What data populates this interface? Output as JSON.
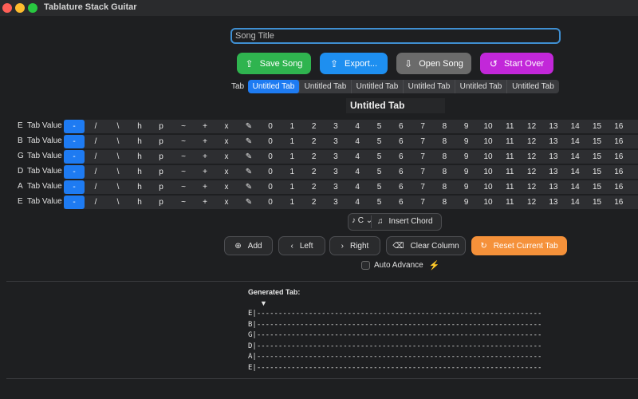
{
  "window": {
    "title": "Tablature Stack Guitar"
  },
  "song": {
    "title_placeholder": "Song Title",
    "title_value": ""
  },
  "actions": {
    "save": "Save Song",
    "export": "Export...",
    "open": "Open Song",
    "start_over": "Start Over"
  },
  "tabs": {
    "label": "Tab",
    "items": [
      "Untitled Tab",
      "Untitled Tab",
      "Untitled Tab",
      "Untitled Tab",
      "Untitled Tab",
      "Untitled Tab"
    ],
    "active_index": 0,
    "current_title": "Untitled Tab"
  },
  "grid": {
    "row_label": "Tab Value",
    "strings": [
      "E",
      "B",
      "G",
      "D",
      "A",
      "E"
    ],
    "symbols": [
      "-",
      "/",
      "\\",
      "h",
      "p",
      "~",
      "+",
      "x"
    ],
    "pencil": "✎",
    "frets": [
      "0",
      "1",
      "2",
      "3",
      "4",
      "5",
      "6",
      "7",
      "8",
      "9",
      "10",
      "11",
      "12",
      "13",
      "14",
      "15",
      "16"
    ],
    "selected_value": "-"
  },
  "chord": {
    "selector_value": "C",
    "insert_label": "Insert Chord"
  },
  "edit": {
    "add": "Add",
    "left": "Left",
    "right": "Right",
    "clear": "Clear Column",
    "reset": "Reset Current Tab"
  },
  "auto_advance": {
    "label": "Auto Advance",
    "checked": false
  },
  "generated": {
    "label": "Generated Tab:",
    "marker": "▼",
    "lines": [
      "E|-------------------------------------------------------------------------------------|",
      "B|-------------------------------------------------------------------------------------|",
      "G|-------------------------------------------------------------------------------------|",
      "D|-------------------------------------------------------------------------------------|",
      "A|-------------------------------------------------------------------------------------|",
      "E|-------------------------------------------------------------------------------------|"
    ]
  },
  "colors": {
    "accent_blue": "#1e7bf2",
    "save_green": "#2fb44f",
    "export_blue": "#1e8ff0",
    "open_gray": "#6b6b6b",
    "start_purple": "#c227d9",
    "reset_orange": "#f5913a"
  }
}
